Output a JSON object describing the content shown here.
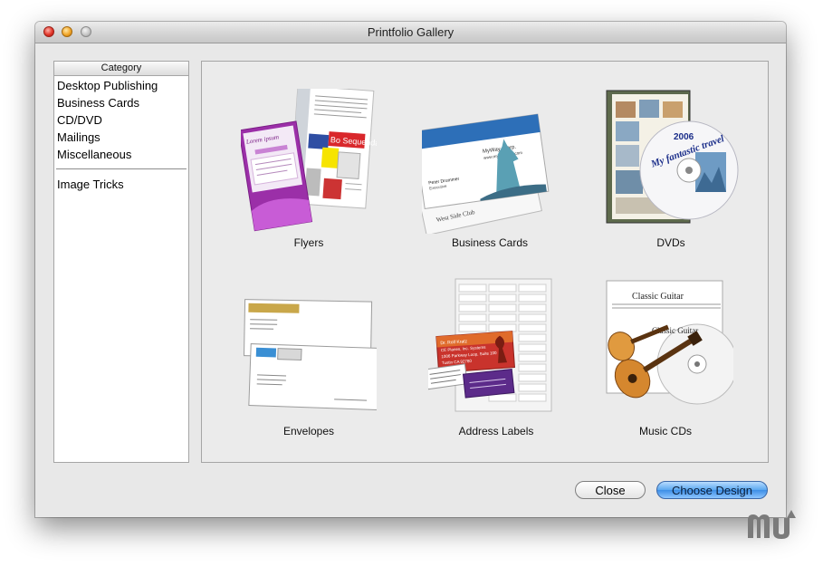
{
  "window": {
    "title": "Printfolio Gallery"
  },
  "sidebar": {
    "header": "Category",
    "items": [
      "Desktop Publishing",
      "Business Cards",
      "CD/DVD",
      "Mailings",
      "Miscellaneous"
    ],
    "extra_items": [
      "Image Tricks"
    ]
  },
  "gallery": {
    "items": [
      {
        "label": "Flyers",
        "card_text": [
          "Lorem ipsum",
          "Trending",
          "Bo Sequenda"
        ]
      },
      {
        "label": "Business Cards",
        "card_text": [
          "MyWay, Corp.",
          "www.mywaycorp.com",
          "Peter Drummer",
          "Executive",
          "West Side Club"
        ]
      },
      {
        "label": "DVDs",
        "card_text": [
          "My fantastic travel",
          "2006"
        ]
      },
      {
        "label": "Envelopes",
        "card_text": []
      },
      {
        "label": "Address Labels",
        "card_text": [
          "Dr. Rolf Kratz",
          "CE Planes, Inc. Systems",
          "1006 Parkway Loop, Suite 100",
          "Tustin CA 92780"
        ]
      },
      {
        "label": "Music CDs",
        "card_text": [
          "Classic Guitar",
          "Classic Guitar"
        ]
      }
    ]
  },
  "buttons": {
    "close": "Close",
    "choose": "Choose Design"
  },
  "watermark": {
    "text": "mu"
  }
}
